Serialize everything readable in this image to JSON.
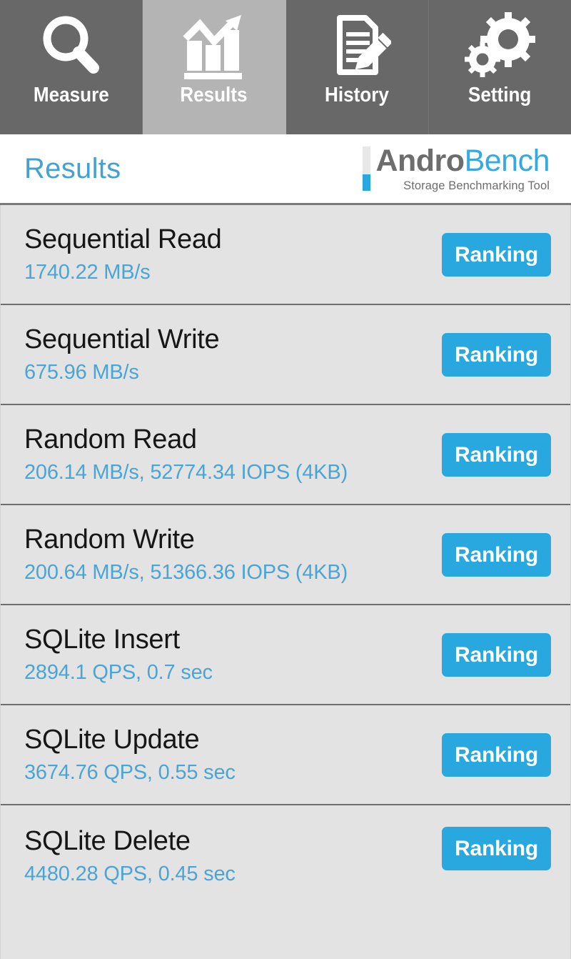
{
  "tabs": [
    {
      "id": "measure",
      "label": "Measure",
      "icon": "magnifier-icon",
      "active": false
    },
    {
      "id": "results",
      "label": "Results",
      "icon": "bar-chart-trend-icon",
      "active": true
    },
    {
      "id": "history",
      "label": "History",
      "icon": "document-pencil-icon",
      "active": false
    },
    {
      "id": "setting",
      "label": "Setting",
      "icon": "gears-icon",
      "active": false
    }
  ],
  "header": {
    "title": "Results",
    "logo": {
      "word_primary": "Andro",
      "word_secondary": "Bench",
      "tagline": "Storage Benchmarking Tool"
    }
  },
  "results": [
    {
      "name": "Sequential Read",
      "value": "1740.22 MB/s",
      "action": "Ranking"
    },
    {
      "name": "Sequential Write",
      "value": "675.96 MB/s",
      "action": "Ranking"
    },
    {
      "name": "Random Read",
      "value": "206.14 MB/s, 52774.34 IOPS (4KB)",
      "action": "Ranking"
    },
    {
      "name": "Random Write",
      "value": "200.64 MB/s, 51366.36 IOPS (4KB)",
      "action": "Ranking"
    },
    {
      "name": "SQLite Insert",
      "value": "2894.1 QPS, 0.7 sec",
      "action": "Ranking"
    },
    {
      "name": "SQLite Update",
      "value": "3674.76 QPS, 0.55 sec",
      "action": "Ranking"
    },
    {
      "name": "SQLite Delete",
      "value": "4480.28 QPS, 0.45 sec",
      "action": "Ranking"
    }
  ],
  "colors": {
    "accent_blue": "#29a8e0",
    "value_blue": "#4aa5d4",
    "title_blue": "#45a1cf",
    "tab_inactive": "#686868",
    "tab_active": "#b4b4b4",
    "row_background": "#e3e3e3"
  }
}
